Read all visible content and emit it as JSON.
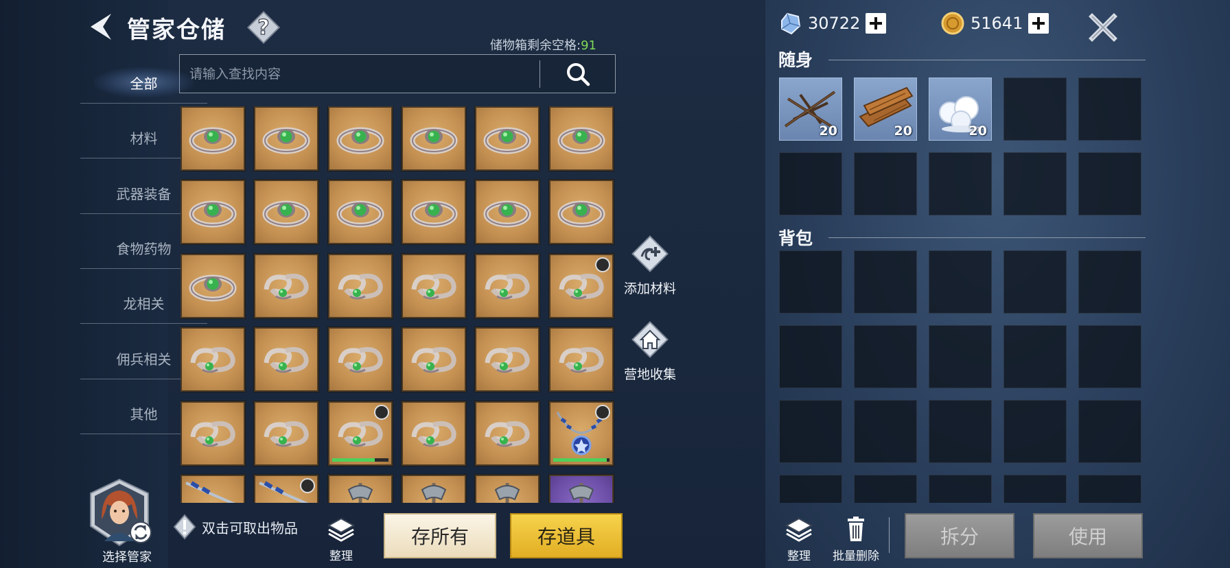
{
  "header": {
    "title": "管家仓储",
    "capacity_label": "储物箱剩余空格:",
    "capacity_value": "91"
  },
  "search": {
    "placeholder": "请输入查找内容"
  },
  "categories": [
    "全部",
    "材料",
    "武器装备",
    "食物药物",
    "龙相关",
    "佣兵相关",
    "其他"
  ],
  "active_category": "全部",
  "storage_items": [
    "ring-round",
    "ring-round",
    "ring-round",
    "ring-round",
    "ring-round",
    "ring-round",
    "ring-round",
    "ring-round",
    "ring-round",
    "ring-round",
    "ring-round",
    "ring-round",
    "ring-round",
    "ring-twist",
    "ring-twist",
    "ring-twist",
    "ring-twist",
    "ring-twist",
    "ring-twist",
    "ring-twist",
    "ring-twist",
    "ring-twist",
    "ring-twist",
    "ring-twist",
    "ring-twist",
    "ring-twist",
    "ring-twist",
    "ring-twist",
    "ring-twist",
    "necklace",
    "spear",
    "spear",
    "axe",
    "axe",
    "axe",
    "axe"
  ],
  "storage_badges": [
    17,
    26,
    29,
    31
  ],
  "storage_durability": {
    "26": 0.75,
    "29": 0.95
  },
  "side_actions": {
    "add_material": "添加材料",
    "camp_collect": "营地收集"
  },
  "bottom_left": {
    "choose_steward": "选择管家",
    "hint": "双击可取出物品",
    "sort": "整理",
    "store_all": "存所有",
    "store_items": "存道具"
  },
  "currency": {
    "gems": "30722",
    "coins": "51641"
  },
  "carry": {
    "title": "随身",
    "items": [
      {
        "icon": "branches",
        "qty": "20"
      },
      {
        "icon": "planks",
        "qty": "20"
      },
      {
        "icon": "snowballs",
        "qty": "20"
      }
    ]
  },
  "backpack": {
    "title": "背包"
  },
  "bottom_right": {
    "sort": "整理",
    "batch_delete": "批量删除",
    "split": "拆分",
    "use": "使用"
  },
  "colors": {
    "capacity_number": "#7ed957",
    "slot_bg": "#c49052",
    "store_items_btn": "#e9bd35"
  }
}
